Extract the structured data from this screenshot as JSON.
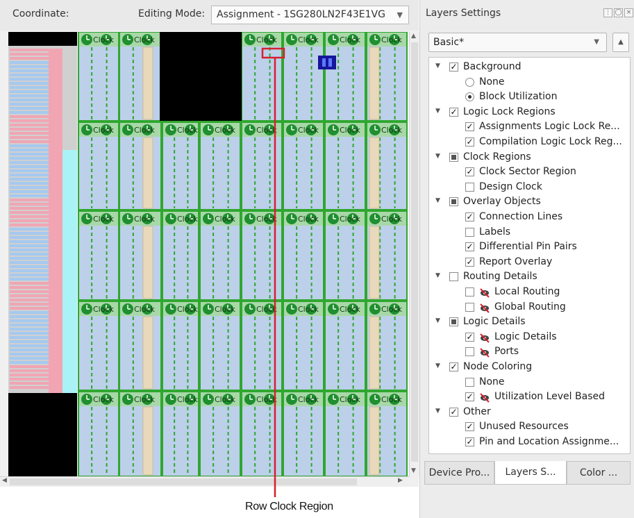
{
  "toolbar": {
    "coordinate_label": "Coordinate:",
    "editing_mode_label": "Editing Mode:",
    "editing_mode_value": "Assignment - 1SG280LN2F43E1VG",
    "dropdown_icon": "chevron-down-icon"
  },
  "canvas": {
    "clock_label": "Clock",
    "callout_label": "Row Clock Region",
    "colors": {
      "clock_region_border": "#2fa72f",
      "clock_header": "#a8d8a8",
      "lab_column": "#bcd0ea",
      "dsp_column": "#e7d9b9",
      "io_pink": "#f1a5b3",
      "io_cyan": "#a9f3f6",
      "io_blue": "#a5c9f0",
      "highlight_box": "#d6202e",
      "selected_block": "#16169a",
      "unused_black": "#000000"
    }
  },
  "panel": {
    "title": "Layers Settings",
    "header_buttons": [
      "pin-icon",
      "restore-icon",
      "close-icon"
    ],
    "preset_value": "Basic*",
    "tree": [
      {
        "level": 0,
        "label": "Background",
        "control": "check",
        "state": "checked",
        "expanded": true
      },
      {
        "level": 1,
        "label": "None",
        "control": "radio",
        "state": "off"
      },
      {
        "level": 1,
        "label": "Block Utilization",
        "control": "radio",
        "state": "on"
      },
      {
        "level": 0,
        "label": "Logic Lock Regions",
        "control": "check",
        "state": "checked",
        "expanded": true
      },
      {
        "level": 1,
        "label": "Assignments Logic Lock Re...",
        "control": "check",
        "state": "checked"
      },
      {
        "level": 1,
        "label": "Compilation Logic Lock Reg...",
        "control": "check",
        "state": "checked"
      },
      {
        "level": 0,
        "label": "Clock Regions",
        "control": "check",
        "state": "partial",
        "expanded": true
      },
      {
        "level": 1,
        "label": "Clock Sector Region",
        "control": "check",
        "state": "checked"
      },
      {
        "level": 1,
        "label": "Design Clock",
        "control": "check",
        "state": "unchecked"
      },
      {
        "level": 0,
        "label": "Overlay Objects",
        "control": "check",
        "state": "partial",
        "expanded": true
      },
      {
        "level": 1,
        "label": "Connection Lines",
        "control": "check",
        "state": "checked"
      },
      {
        "level": 1,
        "label": "Labels",
        "control": "check",
        "state": "unchecked"
      },
      {
        "level": 1,
        "label": "Differential Pin Pairs",
        "control": "check",
        "state": "checked"
      },
      {
        "level": 1,
        "label": "Report Overlay",
        "control": "check",
        "state": "checked"
      },
      {
        "level": 0,
        "label": "Routing Details",
        "control": "check",
        "state": "unchecked",
        "expanded": true
      },
      {
        "level": 1,
        "label": "Local Routing",
        "control": "check",
        "state": "unchecked",
        "icon": "hidden-eye-icon"
      },
      {
        "level": 1,
        "label": "Global Routing",
        "control": "check",
        "state": "unchecked",
        "icon": "hidden-eye-icon"
      },
      {
        "level": 0,
        "label": "Logic Details",
        "control": "check",
        "state": "partial",
        "expanded": true
      },
      {
        "level": 1,
        "label": "Logic Details",
        "control": "check",
        "state": "checked",
        "icon": "hidden-eye-icon"
      },
      {
        "level": 1,
        "label": "Ports",
        "control": "check",
        "state": "unchecked",
        "icon": "hidden-eye-icon"
      },
      {
        "level": 0,
        "label": "Node Coloring",
        "control": "check",
        "state": "checked",
        "expanded": true
      },
      {
        "level": 1,
        "label": "None",
        "control": "check",
        "state": "unchecked"
      },
      {
        "level": 1,
        "label": "Utilization Level Based",
        "control": "check",
        "state": "checked",
        "icon": "hidden-eye-icon"
      },
      {
        "level": 0,
        "label": "Other",
        "control": "check",
        "state": "checked",
        "expanded": true
      },
      {
        "level": 1,
        "label": "Unused Resources",
        "control": "check",
        "state": "checked"
      },
      {
        "level": 1,
        "label": "Pin and Location Assignme...",
        "control": "check",
        "state": "checked"
      }
    ],
    "tabs": [
      {
        "label": "Device Pro...",
        "active": false
      },
      {
        "label": "Layers S...",
        "active": true
      },
      {
        "label": "Color ...",
        "active": false
      }
    ]
  }
}
